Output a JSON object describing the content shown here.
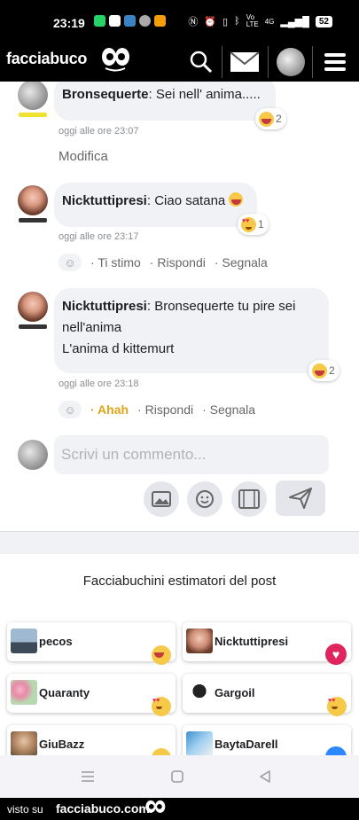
{
  "status_bar": {
    "time": "23:19",
    "network": "Vo LTE",
    "signal": "4G",
    "battery": "52"
  },
  "app_bar": {
    "brand": "facciabuco",
    "icons": [
      "search-icon",
      "mail-icon",
      "moon-avatar-icon",
      "menu-icon"
    ]
  },
  "comments": [
    {
      "author": "Bronsequerte",
      "text": ": Sei nell' anima.....",
      "time": "oggi alle ore 23:07",
      "reaction_count": "2",
      "edit_label": "Modifica"
    },
    {
      "author": "Nicktuttipresi",
      "text": ": Ciao satana",
      "time": "oggi alle ore 23:17",
      "reaction_count": "1",
      "actions": [
        "Ti stimo",
        "Rispondi",
        "Segnala"
      ]
    },
    {
      "author": "Nicktuttipresi",
      "text_line1": ": Bronsequerte tu pire sei",
      "text_line2": "nell'anima",
      "text_line3": "L'anima d kittemurt",
      "time": "oggi alle ore 23:18",
      "reaction_count": "2",
      "actions": [
        "Ahah",
        "Rispondi",
        "Segnala"
      ]
    }
  ],
  "composer": {
    "placeholder": "Scrivi un commento..."
  },
  "estimators": {
    "title": "Facciabuchini estimatori del post",
    "people": [
      {
        "name": "pecos",
        "reaction": "laugh"
      },
      {
        "name": "Nicktuttipresi",
        "reaction": "love"
      },
      {
        "name": "Quaranty",
        "reaction": "heart-eyes"
      },
      {
        "name": "Gargoil",
        "reaction": "heart-eyes"
      },
      {
        "name": "GiuBazz",
        "reaction": "laugh"
      },
      {
        "name": "BaytaDarell",
        "reaction": "like"
      }
    ]
  },
  "colors": {
    "ahah": "#e0a419",
    "love": "#e0245e",
    "like": "#2d88ff"
  },
  "footer": {
    "prefix": "visto su",
    "site": "facciabuco.com"
  }
}
